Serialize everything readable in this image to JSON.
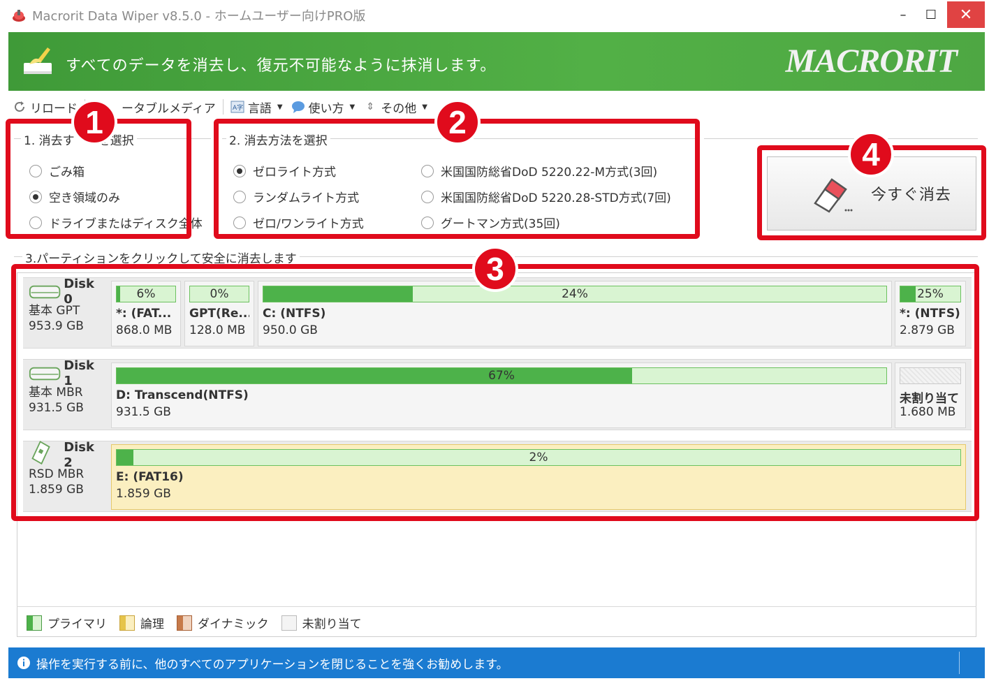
{
  "window": {
    "title": "Macrorit Data Wiper v8.5.0 - ホームユーザー向けPRO版",
    "minimize": "–",
    "maximize": "☐",
    "close": "✕"
  },
  "banner": {
    "text": "すべてのデータを消去し、復元不可能なように抹消します。",
    "brand": "MACRORIT"
  },
  "toolbar": {
    "reload": "リロード",
    "removable": "ータブルメディア",
    "language": "言語",
    "howto": "使い方",
    "other": "その他"
  },
  "step1": {
    "title": "1. 消去す　　を選択",
    "options": [
      {
        "label": "ごみ箱",
        "selected": false
      },
      {
        "label": "空き領域のみ",
        "selected": true
      },
      {
        "label": "ドライブまたはディスク全体",
        "selected": false
      }
    ]
  },
  "step2": {
    "title": "2. 消去方法を選択",
    "options": [
      {
        "label": "ゼロライト方式",
        "selected": true
      },
      {
        "label": "ランダムライト方式",
        "selected": false
      },
      {
        "label": "ゼロ/ワンライト方式",
        "selected": false
      },
      {
        "label": "米国国防総省DoD 5220.22-M方式(3回)",
        "selected": false
      },
      {
        "label": "米国国防総省DoD 5220.28-STD方式(7回)",
        "selected": false
      },
      {
        "label": "グートマン方式(35回)",
        "selected": false
      }
    ]
  },
  "wipe_button": {
    "label": "今すぐ消去"
  },
  "step3": {
    "title": "3.パーティションをクリックして安全に消去します"
  },
  "badges": [
    "1",
    "2",
    "3",
    "4"
  ],
  "disks": [
    {
      "name": "Disk 0",
      "type": "基本 GPT",
      "size": "953.9 GB",
      "partitions": [
        {
          "pct": "6%",
          "fill": 0.06,
          "name": "*: (FAT...",
          "size": "868.0 MB"
        },
        {
          "pct": "0%",
          "fill": 0.0,
          "name": "GPT(Re...",
          "size": "128.0 MB"
        },
        {
          "pct": "24%",
          "fill": 0.24,
          "name": "C: (NTFS)",
          "size": "950.0 GB"
        },
        {
          "pct": "25%",
          "fill": 0.25,
          "name": "*: (NTFS)",
          "size": "2.879 GB"
        }
      ]
    },
    {
      "name": "Disk 1",
      "type": "基本 MBR",
      "size": "931.5 GB",
      "partitions": [
        {
          "pct": "67%",
          "fill": 0.67,
          "name": "D: Transcend(NTFS)",
          "size": "931.5 GB"
        },
        {
          "pct": "",
          "fill": 0.0,
          "name": "未割り当て",
          "size": "1.680 MB"
        }
      ]
    },
    {
      "name": "Disk 2",
      "type": "RSD MBR",
      "size": "1.859 GB",
      "partitions": [
        {
          "pct": "2%",
          "fill": 0.02,
          "name": "E: (FAT16)",
          "size": "1.859 GB"
        }
      ]
    }
  ],
  "legend": {
    "primary": "プライマリ",
    "logical": "論理",
    "dynamic": "ダイナミック",
    "unallocated": "未割り当て"
  },
  "status": {
    "text": "操作を実行する前に、他のすべてのアプリケーションを閉じることを強くお勧めします。"
  },
  "colors": {
    "accent_red": "#e00b1c",
    "banner_green": "#4ea743",
    "status_blue": "#1b7bd1",
    "bar_fill": "#4db24a"
  }
}
